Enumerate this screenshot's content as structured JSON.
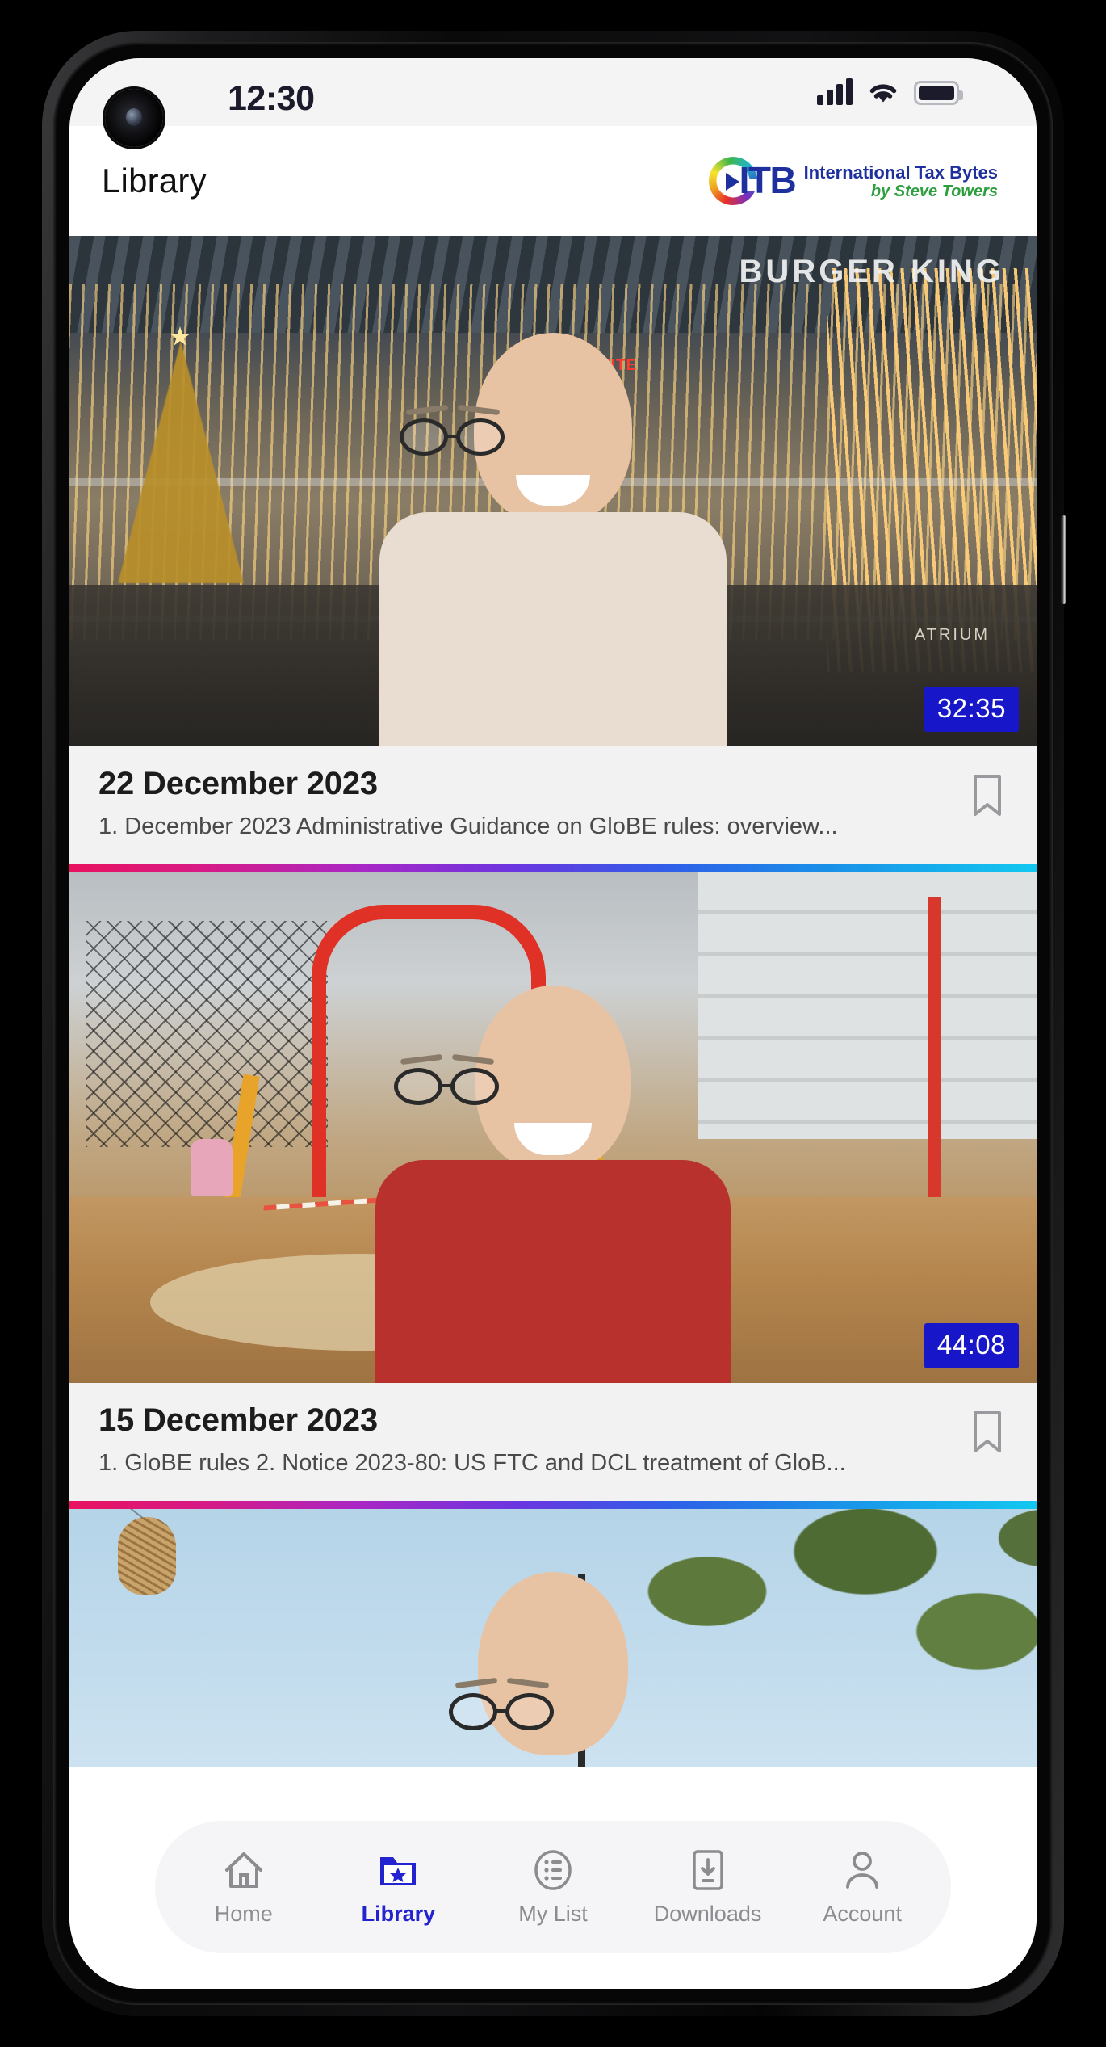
{
  "device": {
    "status_bar": {
      "time": "12:30",
      "icons": [
        "signal-bars-icon",
        "wifi-icon",
        "battery-icon"
      ],
      "battery_level": "full"
    },
    "camera": "punch-hole-camera"
  },
  "header": {
    "title": "Library",
    "logo": {
      "mark_text": "ITB",
      "line1": "International Tax Bytes",
      "line2": "by Steve Towers",
      "mark_color": "#1e2f9e",
      "tagline_color": "#2f9e3f"
    }
  },
  "library": {
    "videos": [
      {
        "date": "22 December 2023",
        "description": "1. December 2023 Administrative Guidance on GloBE rules: overview...",
        "duration": "32:35",
        "bookmarked": false,
        "scene": "shopping-mall-christmas"
      },
      {
        "date": "15 December 2023",
        "description": "1. GloBE rules 2. Notice 2023-80: US FTC and DCL treatment of GloB...",
        "duration": "44:08",
        "bookmarked": false,
        "scene": "playground-red-frame"
      },
      {
        "date": "",
        "description": "",
        "duration": "",
        "bookmarked": false,
        "scene": "outdoor-blue-sky-tree"
      }
    ],
    "thumbnail_text": {
      "mall_sign_main": "BURGER KING",
      "mall_sign_red": "BIG APPETITE",
      "mall_sign_atrium": "ATRIUM"
    },
    "divider_gradient": [
      "#e8125f",
      "#a927c4",
      "#2f5fe8",
      "#12c8f0"
    ],
    "duration_badge_color": "#1717c9"
  },
  "bottom_nav": {
    "active": "Library",
    "items": [
      {
        "label": "Home",
        "icon": "home-icon",
        "active": false
      },
      {
        "label": "Library",
        "icon": "folder-star-icon",
        "active": true
      },
      {
        "label": "My List",
        "icon": "list-circle-icon",
        "active": false
      },
      {
        "label": "Downloads",
        "icon": "phone-download-icon",
        "active": false
      },
      {
        "label": "Account",
        "icon": "person-icon",
        "active": false
      }
    ],
    "active_color": "#2323d0",
    "inactive_color": "#8b8b90"
  }
}
